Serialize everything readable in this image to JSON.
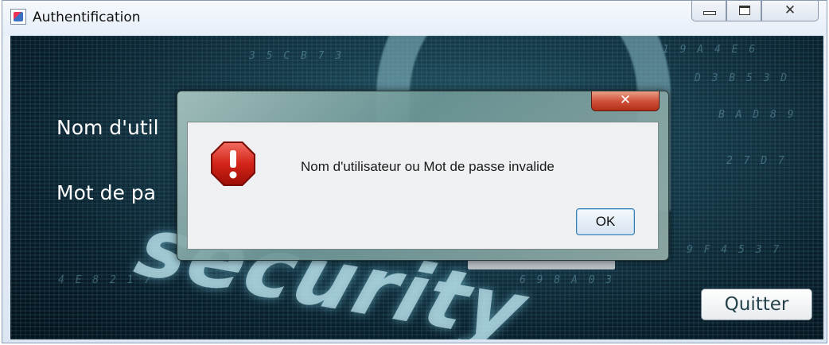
{
  "window": {
    "title": "Authentification",
    "icon": "java-app-icon",
    "controls": {
      "minimize": "minimize-icon",
      "maximize": "maximize-icon",
      "close_symbol": "✕"
    }
  },
  "form": {
    "username_label": "Nom d'util",
    "password_label": "Mot de pa",
    "quit_label": "Quitter"
  },
  "background": {
    "word": "security",
    "digit_rows": [
      "3 5 C B 7 3",
      "1 9 A 4 E 6",
      "D 3 B 5 3 D",
      "B A D 8 9",
      "2 7 D 7",
      "9 F 4 5 3 7",
      "4 E 8 2 1 7",
      "6 9 8 A 0 3"
    ],
    "accent_color": "#173a49"
  },
  "dialog": {
    "close_symbol": "✕",
    "icon": "error-stop-icon",
    "message": "Nom d'utilisateur ou Mot de passe invalide",
    "ok_label": "OK"
  }
}
